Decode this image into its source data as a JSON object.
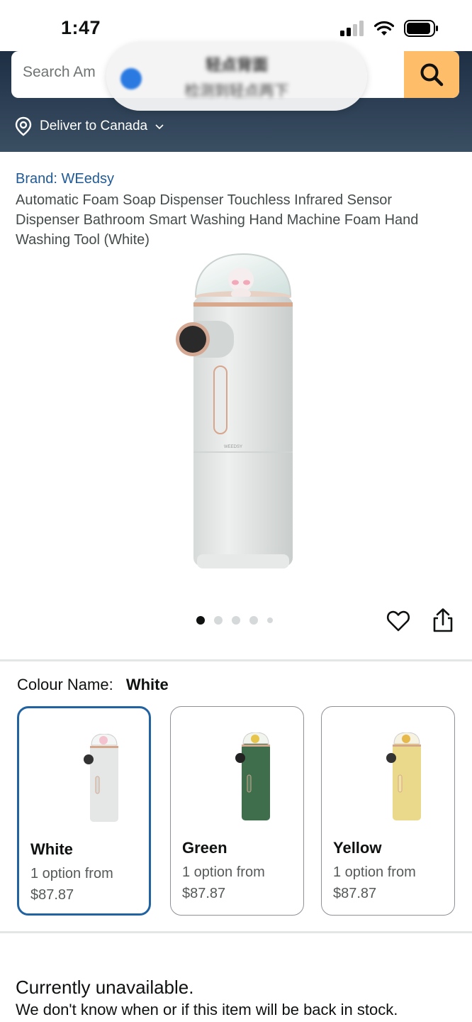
{
  "status_bar": {
    "time": "1:47"
  },
  "search": {
    "placeholder": "Search Amazon",
    "visible_text": "Search Am"
  },
  "toast": {
    "title": "轻点背面",
    "subtitle": "检测到轻点两下"
  },
  "delivery": {
    "text": "Deliver to Canada"
  },
  "product": {
    "brand": "Brand: WEedsy",
    "title": "Automatic Foam Soap Dispenser Touchless Infrared Sensor Dispenser Bathroom Smart Washing Hand Machine Foam Hand Washing Tool (White)",
    "image_count": 5,
    "active_image": 1
  },
  "colour": {
    "label": "Colour Name:",
    "selected": "White",
    "options": [
      {
        "name": "White",
        "option_text": "1 option from",
        "price": "$87.87",
        "color": "#e9ecea"
      },
      {
        "name": "Green",
        "option_text": "1 option from",
        "price": "$87.87",
        "color": "#3f6e4d"
      },
      {
        "name": "Yellow",
        "option_text": "1 option from",
        "price": "$87.87",
        "color": "#ead98a"
      }
    ]
  },
  "availability": {
    "status": "Currently unavailable.",
    "message": "We don't know when or if this item will be back in stock."
  },
  "colors": {
    "header": "#2d4055",
    "search_button": "#febd69",
    "link": "#1f5a96",
    "selected_border": "#2162a1"
  }
}
